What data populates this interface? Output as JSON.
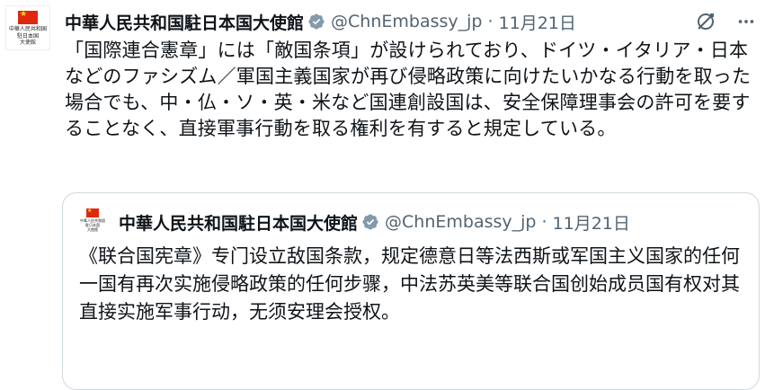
{
  "tweet": {
    "avatar_text": "中華人民共和国\n駐日本国\n大使館",
    "author_name": "中華人民共和国駐日本国大使館",
    "handle": "@ChnEmbassy_jp",
    "separator": "·",
    "date": "11月21日",
    "text": "「国際連合憲章」には「敵国条項」が設けられており、ドイツ・イタリア・日本などのファシズム／軍国主義国家が再び侵略政策に向けたいかなる行動を取った場合でも、中・仏・ソ・英・米など国連創設国は、安全保障理事会の許可を要することなく、直接軍事行動を取る権利を有すると規定している。"
  },
  "quote": {
    "avatar_text": "中華人民共和国\n駐日本国\n大使館",
    "author_name": "中華人民共和国駐日本国大使館",
    "handle": "@ChnEmbassy_jp",
    "separator": "·",
    "date": "11月21日",
    "text": "《联合国宪章》专门设立敌国条款，规定德意日等法西斯或军国主义国家的任何一国有再次实施侵略政策的任何步骤，中法苏英美等联合国创始成员国有权对其直接实施军事行动，无须安理会授权。"
  },
  "icons": {
    "verified": "verified-badge-icon",
    "grok": "grok-icon",
    "more": "more-icon"
  },
  "colors": {
    "verified": "#829aab",
    "flag_red": "#de2910",
    "flag_star": "#ffde00",
    "secondary_text": "#536471",
    "border": "#cfd9de"
  }
}
